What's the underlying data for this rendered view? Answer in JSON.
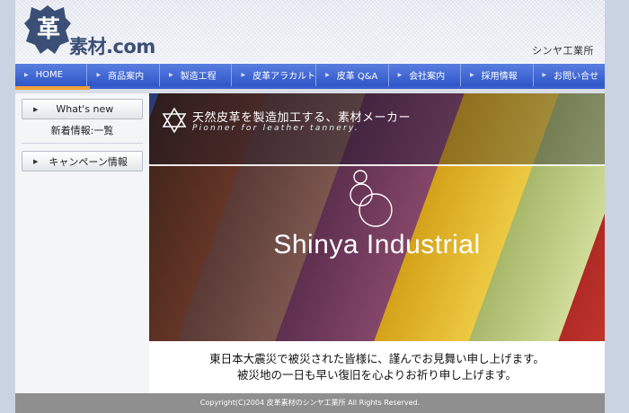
{
  "header": {
    "logo_kanji": "革",
    "logo_text": "素材.com",
    "company_name": "シンヤ工業所"
  },
  "nav": {
    "items": [
      {
        "label": "HOME"
      },
      {
        "label": "商品案内"
      },
      {
        "label": "製造工程"
      },
      {
        "label": "皮革アラカルト"
      },
      {
        "label": "皮革 Q&A"
      },
      {
        "label": "会社案内"
      },
      {
        "label": "採用情報"
      },
      {
        "label": "お問い合せ"
      }
    ]
  },
  "sidebar": {
    "whats_new_label": "What's new",
    "news_link": "新着情報:一覧",
    "campaign_label": "キャンペーン情報"
  },
  "hero": {
    "tagline_jp": "天然皮革を製造加工する、素材メーカー",
    "tagline_en": "Pionner for leather tannery.",
    "title": "Shinya Industrial"
  },
  "notice": {
    "line1": "東日本大震災で被災された皆様に、謹んでお見舞い申し上げます。",
    "line2": "被災地の一日も早い復旧を心よりお祈り申し上げます。"
  },
  "footer": {
    "copyright": "Copyright(C)2004 皮革素材のシンヤ工業所 All Rights Reserved."
  },
  "colors": {
    "nav_blue": "#3a5fcf",
    "nav_accent": "#f0a23a",
    "logo_blue": "#3b4f76",
    "footer_gray": "#8f8f8f"
  }
}
